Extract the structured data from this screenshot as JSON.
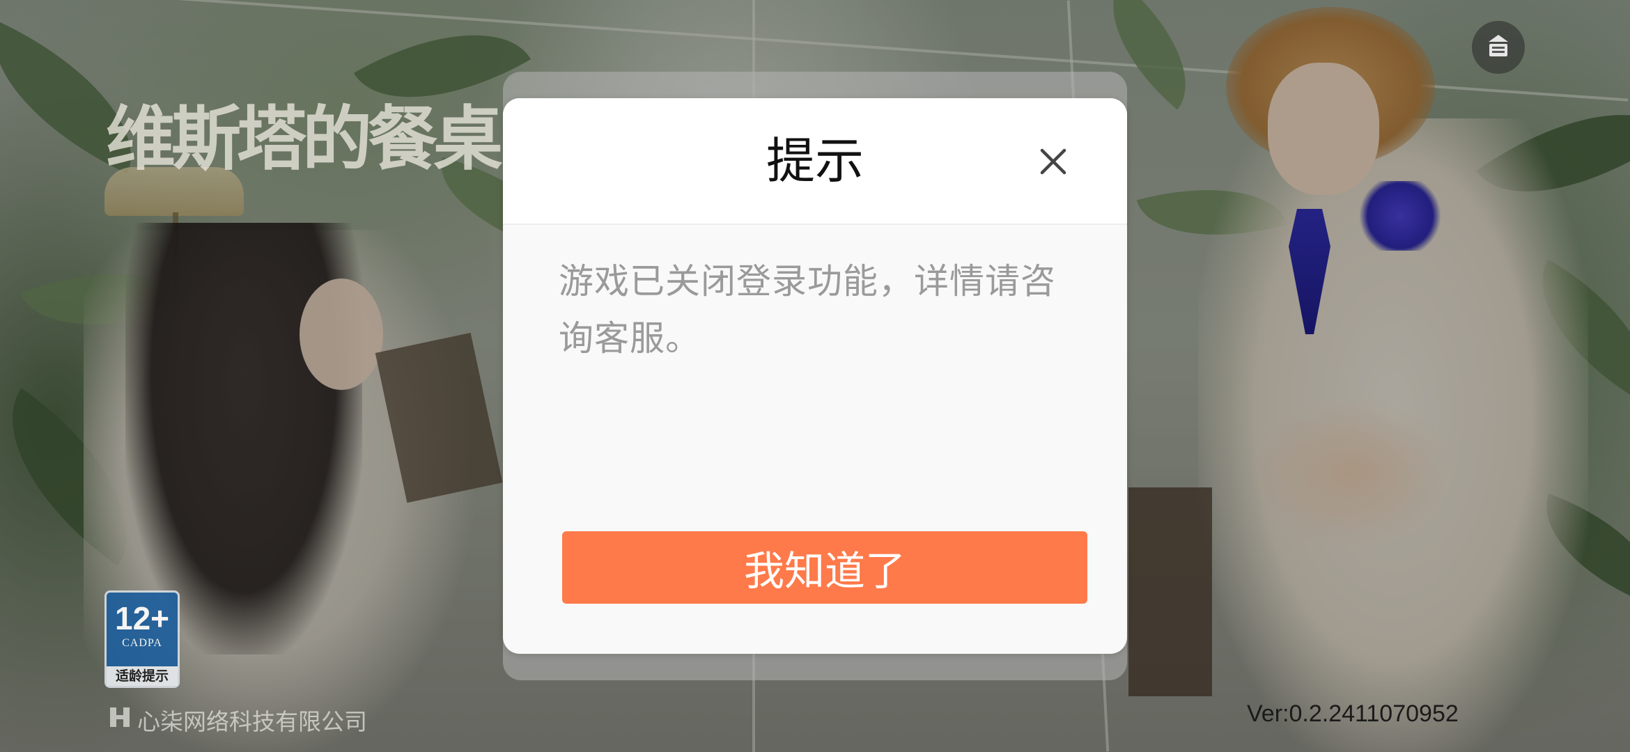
{
  "game": {
    "logo_text": "维斯塔的餐桌",
    "age_rating": {
      "number": "12+",
      "org": "CADPA",
      "tip": "适龄提示"
    },
    "company": "心柒网络科技有限公司",
    "version": "Ver:0.2.2411070952"
  },
  "dialog": {
    "title": "提示",
    "close_icon": "close-icon",
    "message": "游戏已关闭登录功能，详情请咨询客服。",
    "confirm_label": "我知道了"
  },
  "topbar": {
    "notice_icon": "notice-board-icon"
  },
  "colors": {
    "accent": "#ff7a4a",
    "dialog_bg": "#f9f9f9",
    "message_text": "#9a9a9a"
  }
}
